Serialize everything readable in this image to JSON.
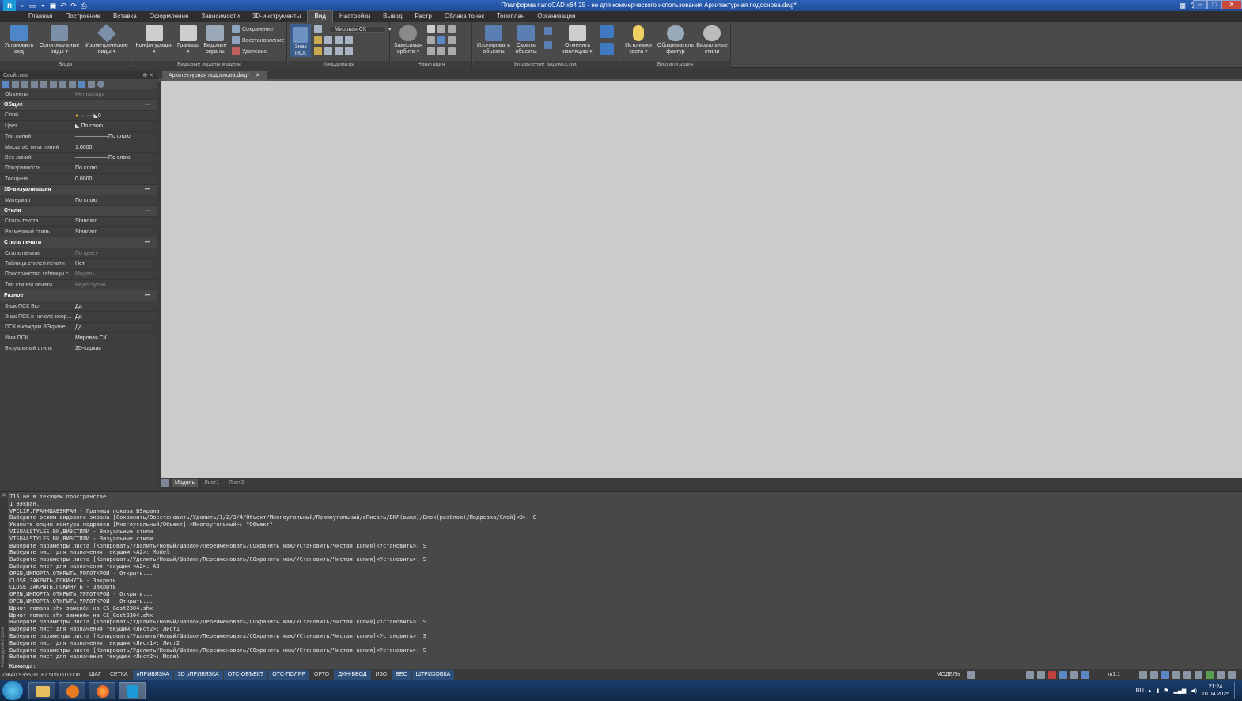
{
  "window": {
    "title": "Платформа nanoCAD x64 25 - не для коммерческого использования Архитектурная подосновa.dwg*"
  },
  "menu": [
    "Главная",
    "Построение",
    "Вставка",
    "Оформление",
    "Зависимости",
    "3D-инструменты",
    "Вид",
    "Настройки",
    "Вывод",
    "Растр",
    "Облака точек",
    "Топоплан",
    "Организация"
  ],
  "menu_active": "Вид",
  "ribbon": {
    "views": {
      "title": "Виды",
      "b1": "Установить\nвид",
      "b2": "Ортогональные\nвиды ▾",
      "b3": "Изометрические\nвиды ▾"
    },
    "vports": {
      "title": "Видовые экраны модели",
      "b1": "Конфигурация\n▾",
      "b2": "Границы\n▾",
      "b3": "Видовые\nэкраны",
      "s1": "Сохранение",
      "s2": "Восстановление",
      "s3": "Удаление"
    },
    "coords": {
      "title": "Координаты",
      "b1": "Знак\nПСК",
      "ucs": "Мировая СК"
    },
    "nav": {
      "title": "Навигация",
      "b1": "Зависимая\nорбита ▾"
    },
    "vis": {
      "title": "Управление видимостью",
      "b1": "Изолировать\nобъекты",
      "b2": "Скрыть\nобъекты",
      "b3": "Отменить\nизоляцию ▾"
    },
    "viz": {
      "title": "Визуализация",
      "b1": "Источники\nсвета ▾",
      "b2": "Обозреватель\nфактур",
      "b3": "Визуальные\nстили"
    }
  },
  "props": {
    "title": "Свойства",
    "objects_key": "Объекты",
    "objects_val": "Нет набора",
    "sections": {
      "general": "Общие",
      "viz3d": "3D-визуализация",
      "styles": "Стили",
      "print": "Стиль печати",
      "misc": "Разное"
    },
    "general": [
      {
        "k": "Слой",
        "v": "0"
      },
      {
        "k": "Цвет",
        "v": "По слою"
      },
      {
        "k": "Тип линий",
        "v": "——————По слою"
      },
      {
        "k": "Масштаб типа линий",
        "v": "1.0000"
      },
      {
        "k": "Вес линий",
        "v": "——————По слою"
      },
      {
        "k": "Прозрачность",
        "v": "По слою"
      },
      {
        "k": "Толщина",
        "v": "0.0000"
      }
    ],
    "viz3d": [
      {
        "k": "Материал",
        "v": "По слою"
      }
    ],
    "styles": [
      {
        "k": "Стиль текста",
        "v": "Standard"
      },
      {
        "k": "Размерный стиль",
        "v": "Standard"
      }
    ],
    "print": [
      {
        "k": "Стиль печати",
        "v": "По цвету",
        "dim": true
      },
      {
        "k": "Таблица стилей печати",
        "v": "Нет"
      },
      {
        "k": "Пространство таблицы с...",
        "v": "Модель",
        "dim": true
      },
      {
        "k": "Тип стилей печати",
        "v": "Недоступно",
        "dim": true
      }
    ],
    "misc": [
      {
        "k": "Знак ПСК Вкл",
        "v": "Да"
      },
      {
        "k": "Знак ПСК в начале коор...",
        "v": "Да"
      },
      {
        "k": "ПСК в каждом ВЭкране",
        "v": "Да"
      },
      {
        "k": "Имя ПСК",
        "v": "Мировая СК"
      },
      {
        "k": "Визуальный стиль",
        "v": "2D-каркас"
      }
    ]
  },
  "doc_tab": "Архитектурная подосновa.dwg*",
  "layout_tabs": [
    "Модель",
    "Лист1",
    "Лист2"
  ],
  "cmd": {
    "side_label": "Командная строка",
    "lines": [
      "715 не в текущем пространстве.",
      "1 ВЭкран.",
      "VPCLIP,ГРАНИЦАВЭКРАН - Граница показа ВЭкрана",
      "Выберите режим видового экрана [Сохранить/Восстановить/Удалить/1/2/3/4/Объект/Многоугольный/Прямоугольный/вПисать/ВКЛ(выкл)/Блок(разблок)/Подрезка/Слой]<3>: C",
      "Укажите опцию контура подрезки [Многоугольный/Объект] <Многоугольный>: \"Объект\"",
      "VISUALSTYLES,ВИ,ВИЗСТИЛИ - Визуальные стили",
      "VISUALSTYLES,ВИ,ВИЗСТИЛИ - Визуальные стили",
      "Выберите параметры листа [Копировать/Удалить/Новый/Шаблон/Переименовать/СОхранить как/УСтановить/Чистая копия]<Установить>: S",
      "Выберите лист для назначения текущим <A2>: Model",
      "Выберите параметры листа [Копировать/Удалить/Новый/Шаблон/Переименовать/СОхранить как/УСтановить/Чистая копия]<Установить>: S",
      "Выберите лист для назначения текущим <A2>: A3",
      "OPEN,ИМПОРТА,ОТКРЫТЬ,УРЛОТКРОЙ - Открыть...",
      "CLOSE,ЗАКРЫТЬ,ПОКИНУТЬ - Закрыть",
      "CLOSE,ЗАКРЫТЬ,ПОКИНУТЬ - Закрыть",
      "OPEN,ИМПОРТА,ОТКРЫТЬ,УРЛОТКРОЙ - Открыть...",
      "OPEN,ИМПОРТА,ОТКРЫТЬ,УРЛОТКРОЙ - Открыть...",
      "Шрифт romans.shx заменён на CS_Gost2304.shx",
      "Шрифт romans.shx заменён на CS_Gost2304.shx",
      "Выберите параметры листа [Копировать/Удалить/Новый/Шаблон/Переименовать/СОхранить как/УСтановить/Чистая копия]<Установить>: S",
      "Выберите лист для назначения текущим <Лист2>: Лист1",
      "Выберите параметры листа [Копировать/Удалить/Новый/Шаблон/Переименовать/СОхранить как/УСтановить/Чистая копия]<Установить>: S",
      "Выберите лист для назначения текущим <Лист1>: Лист2",
      "Выберите параметры листа [Копировать/Удалить/Новый/Шаблон/Переименовать/СОхранить как/УСтановить/Чистая копия]<Установить>: S",
      "Выберите лист для назначения текущим <Лист2>: Model"
    ],
    "prompt": "Команда:"
  },
  "status": {
    "coords": "23640.9355,31187.5050,0.0000",
    "toggles": [
      {
        "label": "ШАГ",
        "on": false
      },
      {
        "label": "СЕТКА",
        "on": false
      },
      {
        "label": "оПРИВЯЗКА",
        "on": true
      },
      {
        "label": "3D оПРИВЯЗКА",
        "on": true
      },
      {
        "label": "ОТС-ОБЪЕКТ",
        "on": true
      },
      {
        "label": "ОТС-ПОЛЯР",
        "on": true
      },
      {
        "label": "ОРТО",
        "on": false
      },
      {
        "label": "ДИН-ВВОД",
        "on": true
      },
      {
        "label": "ИЗО",
        "on": false
      },
      {
        "label": "ВЕС",
        "on": true
      },
      {
        "label": "ШТРИХОВКА",
        "on": true
      }
    ],
    "model": "МОДЕЛЬ",
    "scale": "m1:1"
  },
  "taskbar": {
    "lang": "RU",
    "time": "21:24",
    "date": "10.04.2025"
  }
}
